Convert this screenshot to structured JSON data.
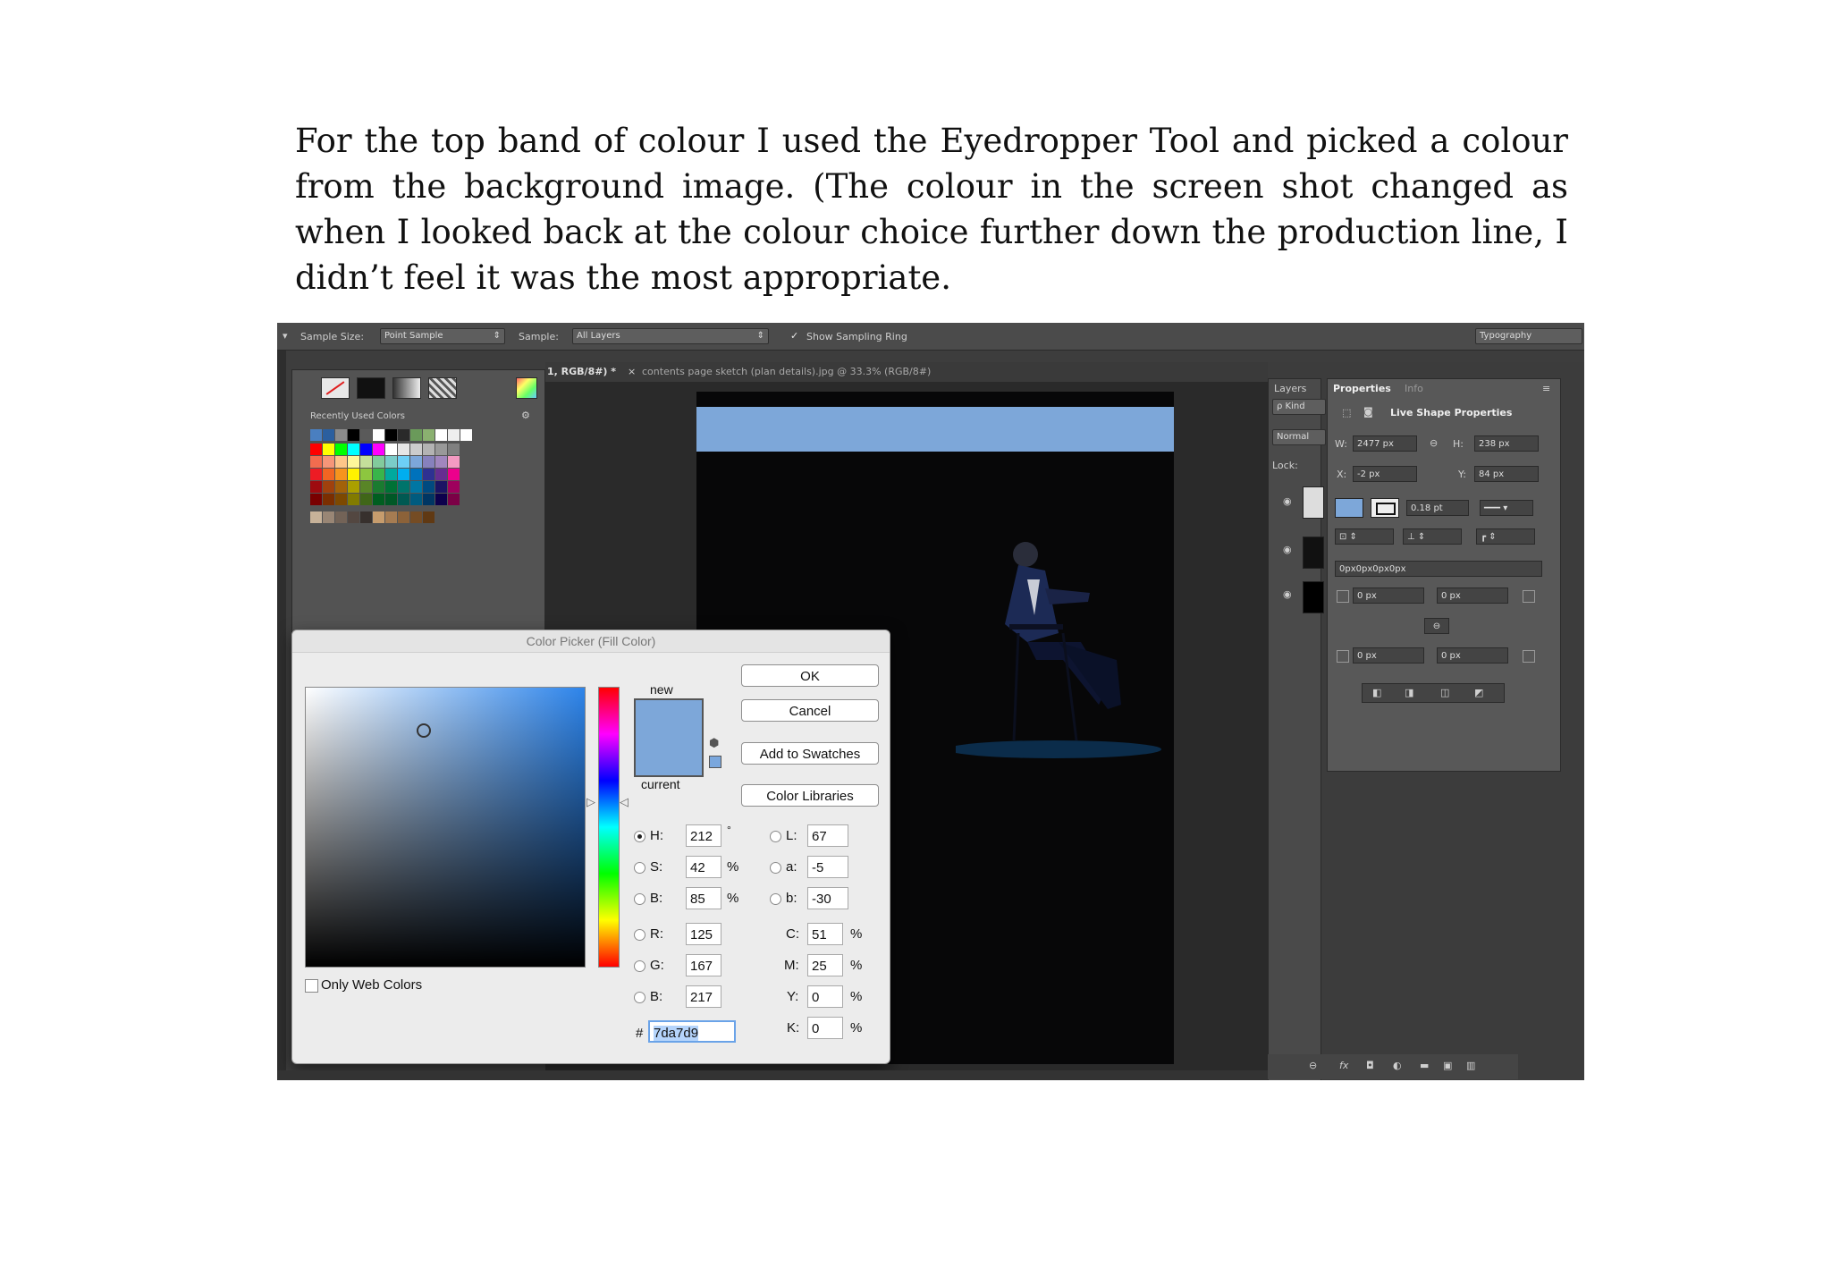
{
  "caption": "For the top band of colour I used the Eyedropper Tool and picked a colour from the background image. (The colour in the screen shot changed as when I looked back at the colour choice further down the production line, I didn’t feel it was the most appropriate.",
  "options_bar": {
    "sample_size_label": "Sample Size:",
    "sample_size_value": "Point Sample",
    "sample_label": "Sample:",
    "sample_value": "All Layers",
    "show_ring_label": "Show Sampling Ring",
    "workspace": "Typography"
  },
  "doc_tabs": {
    "active": "1, RGB/8#) *",
    "other": "contents page sketch (plan details).jpg @ 33.3% (RGB/8#)"
  },
  "swatches_panel": {
    "recent_label": "Recently Used Colors",
    "recent_colors": [
      "#4a7fc0",
      "#2b5f9f",
      "#8a8a8a",
      "#000000",
      "#5a5a5a",
      "#ffffff",
      "#000000",
      "#2a2a2a",
      "#6a9a5a",
      "#8ab070",
      "#ffffff",
      "#eeeeee",
      "#ffffff"
    ],
    "grid_colors": [
      "#ff0000",
      "#ffff00",
      "#00ff00",
      "#00ffff",
      "#0000ff",
      "#ff00ff",
      "#ffffff",
      "#e6e6e6",
      "#cccccc",
      "#b3b3b3",
      "#999999",
      "#808080",
      "#f26c4f",
      "#f69679",
      "#fdc689",
      "#fff799",
      "#c4df9b",
      "#82ca9c",
      "#7accc8",
      "#6dcff6",
      "#7da7d9",
      "#8781bd",
      "#a186be",
      "#f49ac2",
      "#ed1c24",
      "#f26522",
      "#f7941d",
      "#fff200",
      "#8dc63f",
      "#39b54a",
      "#00a99d",
      "#00aeef",
      "#0072bc",
      "#2e3192",
      "#662d91",
      "#ec008c",
      "#9e0b0f",
      "#a0410d",
      "#a36209",
      "#aba000",
      "#598527",
      "#1a7b30",
      "#007236",
      "#00746b",
      "#0076a3",
      "#004a80",
      "#1b1464",
      "#9e005d",
      "#790000",
      "#7b2e00",
      "#7d4900",
      "#827b00",
      "#406618",
      "#005e20",
      "#005826",
      "#005952",
      "#005b7f",
      "#003663",
      "#0d004c",
      "#7b0046"
    ],
    "tone_colors": [
      "#c7b299",
      "#998675",
      "#736357",
      "#534741",
      "#37302d",
      "#c69c6d",
      "#a67c52",
      "#8c6239",
      "#754c24",
      "#603913"
    ]
  },
  "dialog": {
    "title": "Color Picker (Fill Color)",
    "ok": "OK",
    "cancel": "Cancel",
    "add_to_swatches": "Add to Swatches",
    "color_libraries": "Color Libraries",
    "new_label": "new",
    "current_label": "current",
    "only_web_label": "Only Web Colors",
    "fields": {
      "H": {
        "label": "H:",
        "value": "212",
        "unit": "°"
      },
      "S": {
        "label": "S:",
        "value": "42",
        "unit": "%"
      },
      "B": {
        "label": "B:",
        "value": "85",
        "unit": "%"
      },
      "R": {
        "label": "R:",
        "value": "125"
      },
      "G": {
        "label": "G:",
        "value": "167"
      },
      "B2": {
        "label": "B:",
        "value": "217"
      },
      "L": {
        "label": "L:",
        "value": "67"
      },
      "a": {
        "label": "a:",
        "value": "-5"
      },
      "b": {
        "label": "b:",
        "value": "-30"
      },
      "C": {
        "label": "C:",
        "value": "51",
        "unit": "%"
      },
      "M": {
        "label": "M:",
        "value": "25",
        "unit": "%"
      },
      "Y": {
        "label": "Y:",
        "value": "0",
        "unit": "%"
      },
      "K": {
        "label": "K:",
        "value": "0",
        "unit": "%"
      }
    },
    "hex_label": "#",
    "hex_value": "7da7d9",
    "new_color": "#7da7d9"
  },
  "canvas": {
    "band_color": "#7da7d9"
  },
  "layers_panel": {
    "tab": "Layers",
    "kind": "ρ Kind",
    "blend": "Normal",
    "lock_label": "Lock:"
  },
  "properties_panel": {
    "tab_properties": "Properties",
    "tab_info": "Info",
    "title": "Live Shape Properties",
    "w_label": "W:",
    "w_value": "2477 px",
    "h_label": "H:",
    "h_value": "238 px",
    "x_label": "X:",
    "x_value": "-2 px",
    "y_label": "Y:",
    "y_value": "84 px",
    "stroke_width": "0.18 pt",
    "radius_combined": "0px0px0px0px",
    "corner_tl": "0 px",
    "corner_tr": "0 px",
    "corner_bl": "0 px",
    "corner_br": "0 px"
  }
}
